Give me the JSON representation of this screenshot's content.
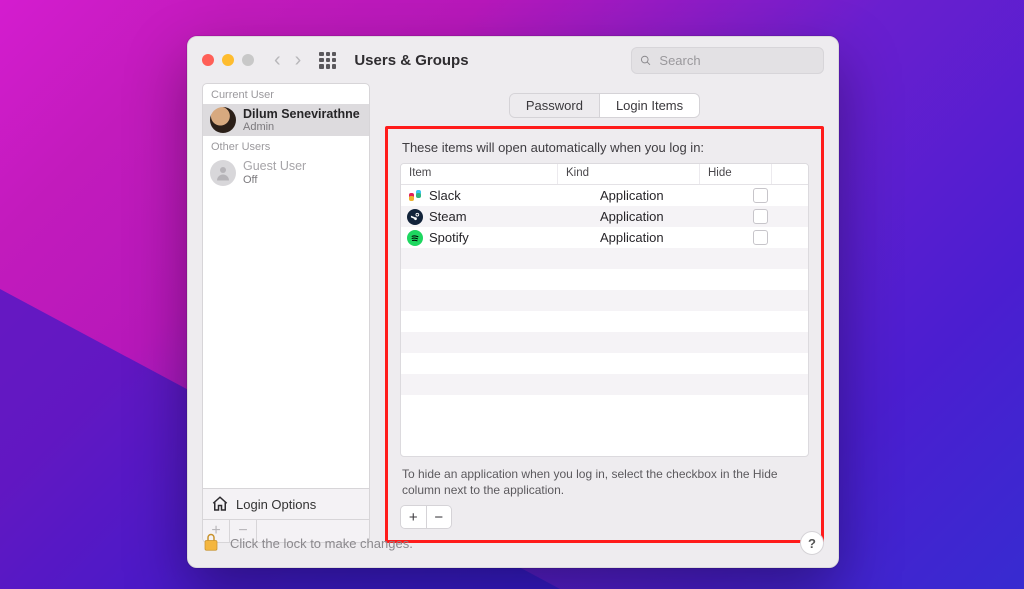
{
  "window": {
    "title": "Users & Groups"
  },
  "search": {
    "placeholder": "Search"
  },
  "sidebar": {
    "sections": {
      "current": "Current User",
      "other": "Other Users"
    },
    "users": [
      {
        "name": "Dilum Senevirathne",
        "role": "Admin"
      },
      {
        "name": "Guest User",
        "role": "Off"
      }
    ],
    "login_options": "Login Options"
  },
  "tabs": {
    "password": "Password",
    "login_items": "Login Items"
  },
  "login_items": {
    "caption": "These items will open automatically when you log in:",
    "columns": {
      "item": "Item",
      "kind": "Kind",
      "hide": "Hide"
    },
    "rows": [
      {
        "icon": "slack",
        "name": "Slack",
        "kind": "Application"
      },
      {
        "icon": "steam",
        "name": "Steam",
        "kind": "Application"
      },
      {
        "icon": "spotify",
        "name": "Spotify",
        "kind": "Application"
      }
    ],
    "hint": "To hide an application when you log in, select the checkbox in the Hide column next to the application."
  },
  "footer": {
    "lock_text": "Click the lock to make changes."
  }
}
